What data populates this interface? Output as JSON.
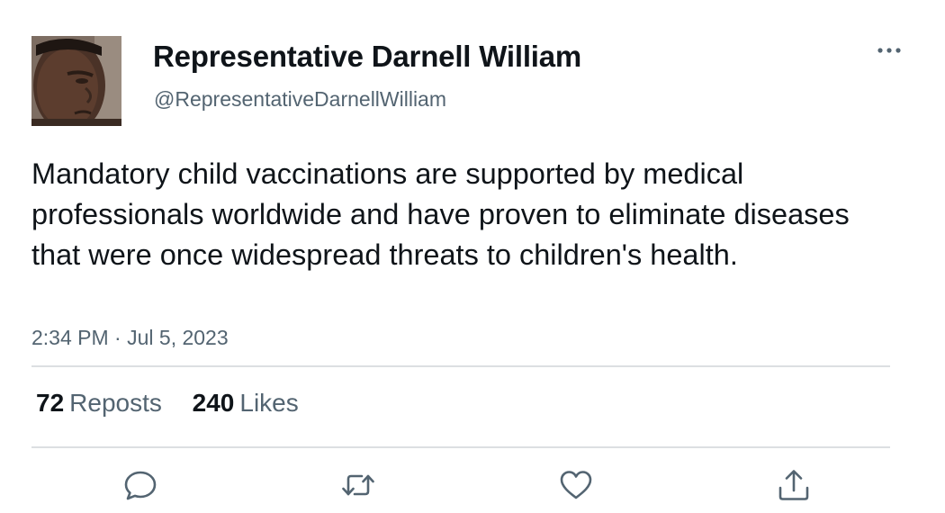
{
  "author": {
    "display_name": "Representative Darnell William",
    "handle": "@RepresentativeDarnellWilliam",
    "avatar_icon": "profile-photo"
  },
  "tweet": {
    "text": "Mandatory child vaccinations are supported by medical professionals worldwide and have proven to eliminate diseases that were once widespread threats to children's health.",
    "time": "2:34 PM",
    "separator": "·",
    "date": "Jul 5, 2023"
  },
  "stats": {
    "reposts_count": "72",
    "reposts_label": "Reposts",
    "likes_count": "240",
    "likes_label": "Likes"
  },
  "actions": {
    "reply_icon": "reply-icon",
    "repost_icon": "repost-icon",
    "like_icon": "heart-icon",
    "share_icon": "share-icon",
    "more_icon": "more-icon"
  },
  "colors": {
    "text_primary": "#0f1419",
    "text_secondary": "#536471",
    "divider": "#dcdfe2",
    "icon": "#536471"
  }
}
